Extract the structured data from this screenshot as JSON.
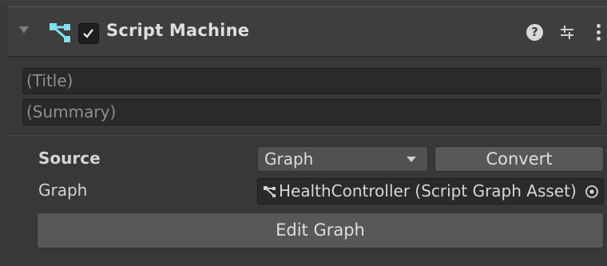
{
  "header": {
    "title": "Script Machine",
    "enabled": true,
    "help_icon_glyph": "?"
  },
  "fields": {
    "title_placeholder": "(Title)",
    "summary_placeholder": "(Summary)"
  },
  "properties": {
    "source_label": "Source",
    "source_value": "Graph",
    "convert_label": "Convert",
    "graph_label": "Graph",
    "graph_value": "HealthController (Script Graph Asset)",
    "edit_graph_label": "Edit Graph"
  },
  "icons": {
    "foldout": "triangle-down-icon",
    "component": "script-graph-icon",
    "help": "help-icon",
    "presets": "presets-icon",
    "menu": "kebab-menu-icon",
    "picker": "object-picker-icon"
  },
  "colors": {
    "background": "#383838",
    "accent_graph_icon": "#7fe0f0",
    "field": "#2a2a2a"
  }
}
